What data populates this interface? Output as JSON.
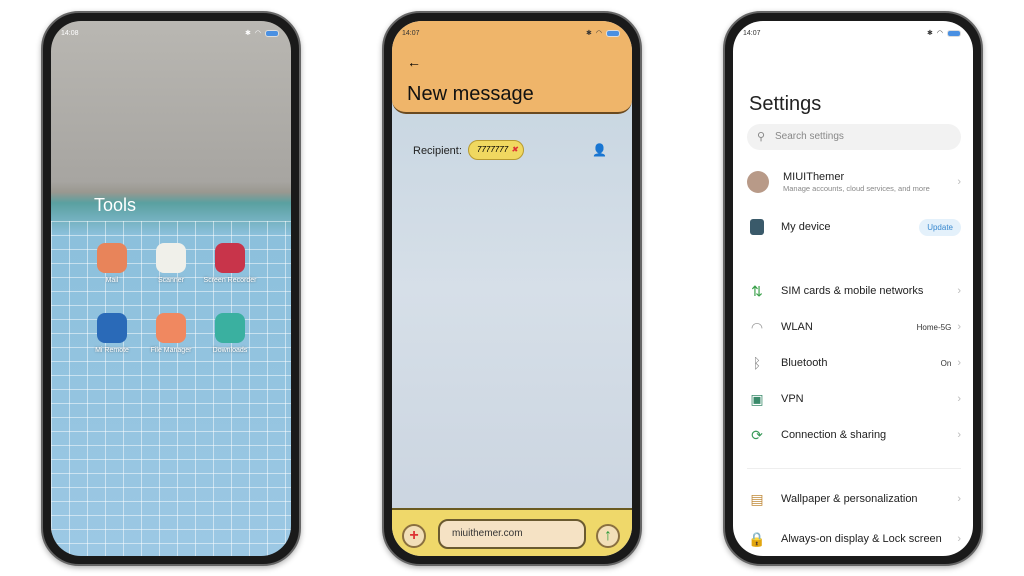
{
  "phone1": {
    "time": "14:08",
    "folder": "Tools",
    "apps": [
      {
        "label": "Mail",
        "color": "#e8845a"
      },
      {
        "label": "Scanner",
        "color": "#f0f0ea"
      },
      {
        "label": "Screen Recorder",
        "color": "#c8344a"
      },
      {
        "label": "Mi Remote",
        "color": "#2a6ab8"
      },
      {
        "label": "File Manager",
        "color": "#f08860"
      },
      {
        "label": "Downloads",
        "color": "#3ab0a0"
      }
    ]
  },
  "phone2": {
    "time": "14:07",
    "back": "←",
    "title": "New message",
    "recipient_label": "Recipient:",
    "recipient_chip": "7777777",
    "chip_remove": "✖",
    "contact_icon": "👤",
    "input_value": "miuithemer.com",
    "add": "+",
    "send": "↑"
  },
  "phone3": {
    "time": "14:07",
    "title": "Settings",
    "search_placeholder": "Search settings",
    "account": {
      "name": "MIUIThemer",
      "sub": "Manage accounts, cloud services, and more"
    },
    "device": {
      "label": "My device",
      "badge": "Update"
    },
    "items": [
      {
        "label": "SIM cards & mobile networks",
        "value": "",
        "icon": "⇅",
        "color": "#3aa04a"
      },
      {
        "label": "WLAN",
        "value": "Home-5G",
        "icon": "◠",
        "color": "#999"
      },
      {
        "label": "Bluetooth",
        "value": "On",
        "icon": "ᛒ",
        "color": "#888"
      },
      {
        "label": "VPN",
        "value": "",
        "icon": "▣",
        "color": "#3a8a6a"
      },
      {
        "label": "Connection & sharing",
        "value": "",
        "icon": "⟳",
        "color": "#3a9a5a"
      },
      {
        "label": "Wallpaper & personalization",
        "value": "",
        "icon": "▤",
        "color": "#c08a3a"
      },
      {
        "label": "Always-on display & Lock screen",
        "value": "",
        "icon": "🔒",
        "color": "#3a8a4a"
      }
    ]
  }
}
